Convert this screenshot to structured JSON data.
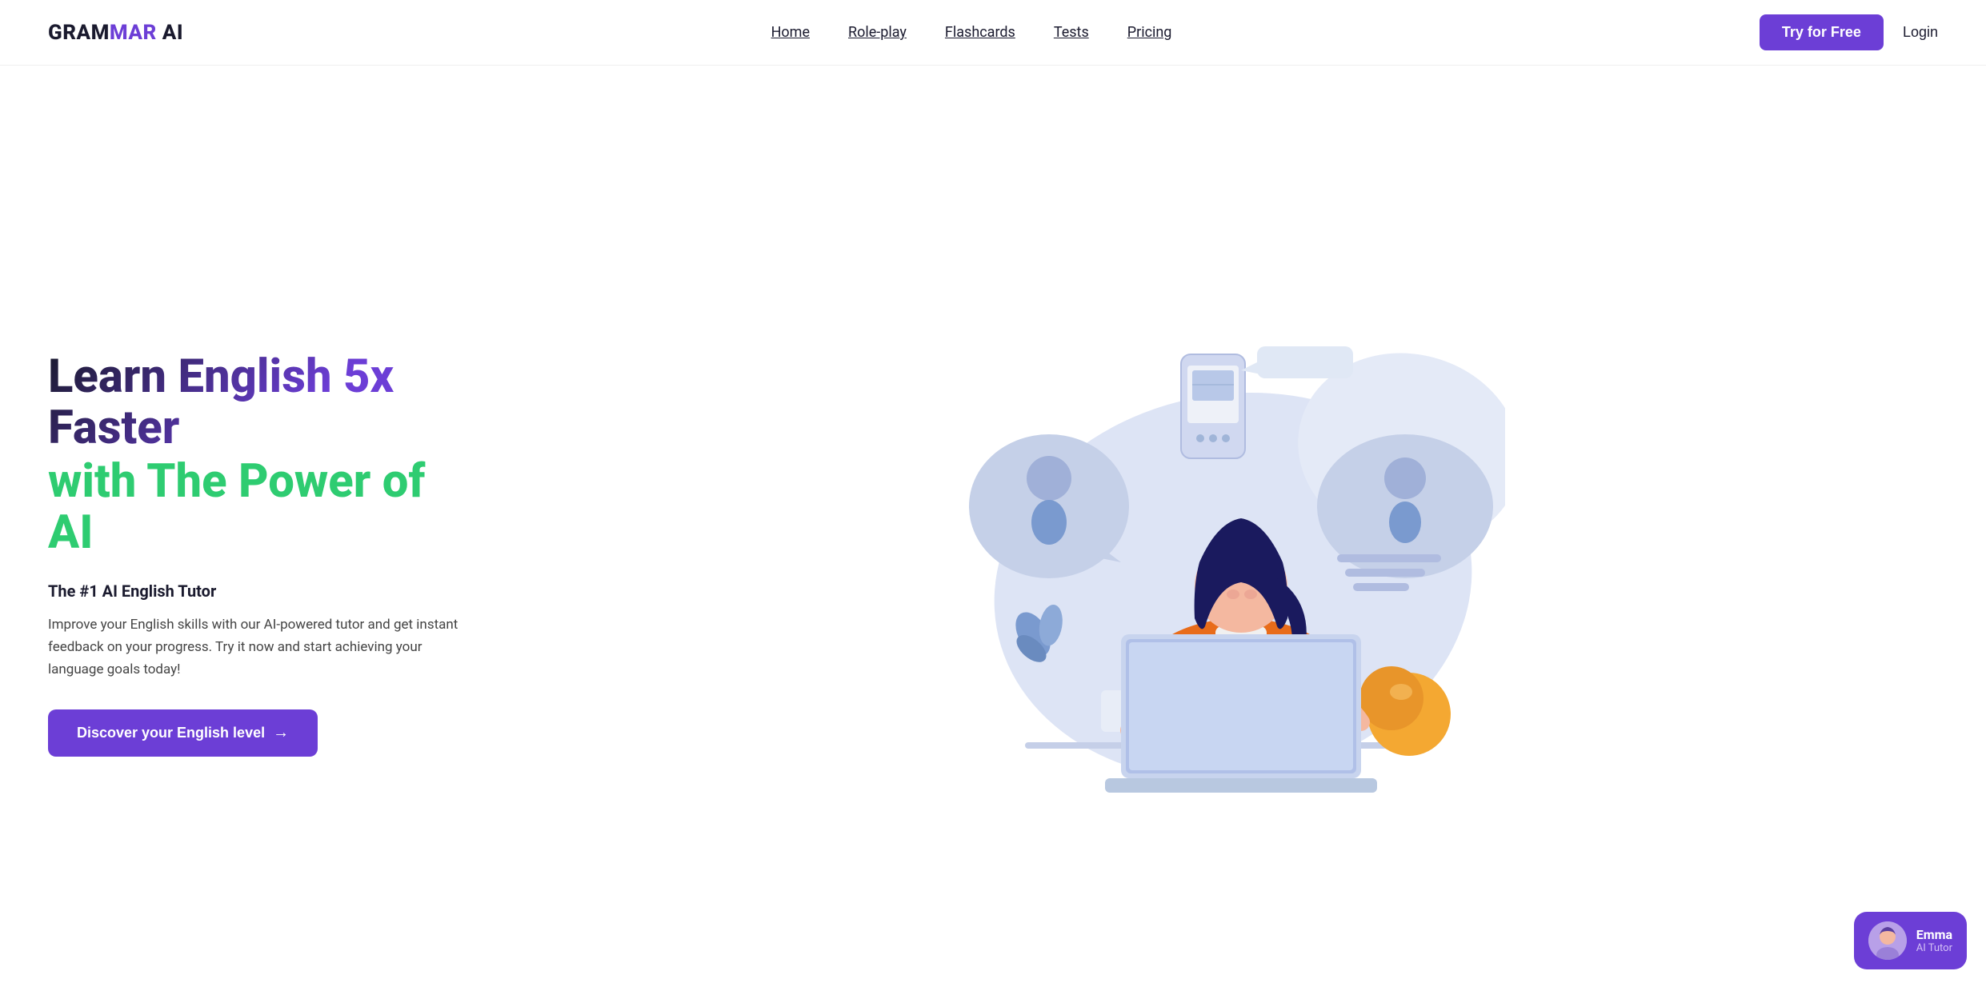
{
  "logo": {
    "text": "GRAMMAR AI",
    "part1": "GRAM",
    "part2": "MAR",
    "part3": " AI"
  },
  "nav": {
    "links": [
      {
        "label": "Home",
        "id": "home"
      },
      {
        "label": "Role-play",
        "id": "role-play"
      },
      {
        "label": "Flashcards",
        "id": "flashcards"
      },
      {
        "label": "Tests",
        "id": "tests"
      },
      {
        "label": "Pricing",
        "id": "pricing"
      }
    ],
    "try_button": "Try for Free",
    "login_button": "Login"
  },
  "hero": {
    "title_line1": "Learn English 5x Faster",
    "title_line2": "with The Power of AI",
    "subtitle": "The #1 AI English Tutor",
    "description": "Improve your English skills with our AI-powered tutor and get instant feedback on your progress. Try it now and start achieving your language goals today!",
    "cta_button": "Discover your English level",
    "cta_arrow": "→"
  },
  "emma": {
    "name": "Emma",
    "role": "AI Tutor"
  },
  "colors": {
    "purple": "#6c3ed6",
    "green": "#2ecc71",
    "dark": "#1a1a2e",
    "light_blue": "#c5cfe8",
    "blob": "#dde4f5"
  }
}
